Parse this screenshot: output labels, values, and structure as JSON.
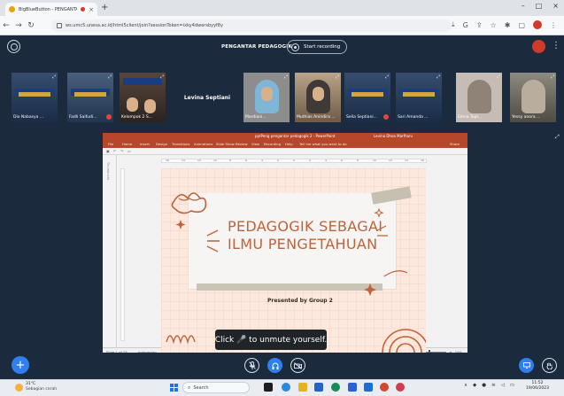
{
  "browser": {
    "tab_title": "BigBlueButton - PENGANTA...",
    "tab_close": "×",
    "new_tab": "+",
    "url": "ws.umc5.unesa.ac.id/html5client/join?sessionToken=ixky4dwersbyyf8y",
    "window_controls": [
      "–",
      "□",
      "×"
    ]
  },
  "meeting": {
    "title": "PENGANTAR PEDAGOGIK",
    "record_label": "Start recording"
  },
  "participants": [
    {
      "name": "Dio Nabasya ..."
    },
    {
      "name": "Fadli Saifudi..."
    },
    {
      "name": "Kelompok 2 S..."
    },
    {
      "name": "Levina Septiani"
    },
    {
      "name": "Mardiani..."
    },
    {
      "name": "Muthias Anindira ..."
    },
    {
      "name": "Selia Septiani..."
    },
    {
      "name": "Sari Amanda ..."
    },
    {
      "name": "Elena Topl..."
    },
    {
      "name": "Yessy anora ..."
    }
  ],
  "ppt": {
    "title": "pptPeng pengantar pedagogik 2 - PowerPoint",
    "user": "Levina Dhea Marfhani",
    "menu": [
      "File",
      "Home",
      "Insert",
      "Design",
      "Transitions",
      "Animations",
      "Slide Show",
      "Review",
      "View",
      "Recording",
      "Help",
      "Tell me what you want to do",
      "Share"
    ],
    "thumb_label": "Thumbnails",
    "ruler_marks": [
      "16",
      "14",
      "12",
      "10",
      "8",
      "6",
      "4",
      "2",
      "0",
      "2",
      "4",
      "6",
      "8",
      "10",
      "12",
      "14",
      "16"
    ],
    "status": [
      "Slide 1 of 25",
      "Indonesian",
      "Accessibility: Investigate"
    ],
    "status_right": [
      "Notes",
      "Comments"
    ],
    "zoom": "74%"
  },
  "slide": {
    "title_line1": "PEDAGOGIK SEBAGAI",
    "title_line2": "ILMU PENGETAHUAN",
    "presented_by": "Presented by Group 2",
    "accent_color": "#c0623a"
  },
  "toast": {
    "text": "Click 🎤 to unmute yourself."
  },
  "taskbar": {
    "temperature": "31°C",
    "condition": "Sebagian cerah",
    "search": "Search",
    "time": "11:52",
    "date": "19/06/2023"
  }
}
